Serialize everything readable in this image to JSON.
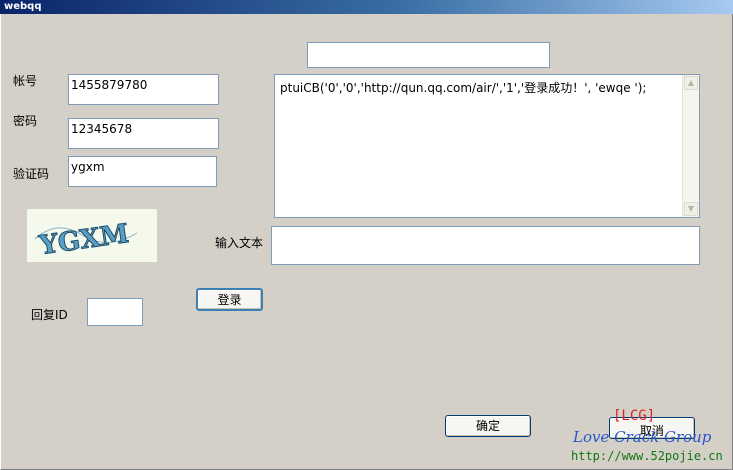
{
  "window": {
    "title": "webqq"
  },
  "form": {
    "account_label": "帐号",
    "account_value": "1455879780",
    "password_label": "密码",
    "password_value": "12345678",
    "verify_label": "验证码",
    "verify_value": "ygxm",
    "captcha_text": "YGXM",
    "reply_id_label": "回复ID",
    "reply_id_value": "",
    "login_button": "登录"
  },
  "top_field": {
    "value": ""
  },
  "response": {
    "text": "ptuiCB('0','0','http://qun.qq.com/air/','1','登录成功！', 'ewqe ');"
  },
  "input_text": {
    "label": "输入文本",
    "value": ""
  },
  "footer": {
    "ok_button": "确定",
    "cancel_button": "取消"
  },
  "watermark": {
    "tag": "[LCG]",
    "group": "Love Crack Group",
    "url": "http://www.52pojie.cn"
  }
}
